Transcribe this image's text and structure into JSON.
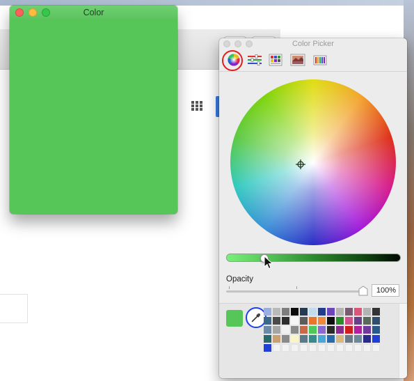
{
  "color_window": {
    "title": "Color",
    "fill_color": "#55c657"
  },
  "color_picker": {
    "title": "Color Picker",
    "mode_tabs": [
      {
        "name": "color-wheel",
        "icon": "color-wheel-icon",
        "selected": true
      },
      {
        "name": "color-sliders",
        "icon": "sliders-icon",
        "selected": false
      },
      {
        "name": "color-palettes",
        "icon": "palette-icon",
        "selected": false
      },
      {
        "name": "image-palettes",
        "icon": "image-palette-icon",
        "selected": false
      },
      {
        "name": "pencils",
        "icon": "pencils-icon",
        "selected": false
      }
    ],
    "brightness_level": 0.22,
    "opacity_label": "Opacity",
    "opacity_value": "100%",
    "current_color": "#55c657",
    "palette_rows": [
      [
        "#9aaee0",
        "#b9b9b9",
        "#7d7d7d",
        "#0a0a0a",
        "#253a53",
        "#c2dcef",
        "#1f3d8a",
        "#6a46ba",
        "#b3b3b3",
        "#7a5a6e",
        "#d9557a",
        "#b3b3b3",
        "#343434"
      ],
      [
        "#3a6a8a",
        "#4a4a4a",
        "#2c2c2c",
        "#f5f5f5",
        "#5c5c5c",
        "#e7762a",
        "#f08a3a",
        "#0f0f0f",
        "#2a8f2a",
        "#d44f8a",
        "#6a3f8a",
        "#5a6a5a",
        "#2f4f6f"
      ],
      [
        "#6a8aaa",
        "#a5a5a5",
        "#f0f0f0",
        "#8a8a8a",
        "#c86a4a",
        "#4ec85a",
        "#8a6ad0",
        "#2a2a2a",
        "#8a2a8a",
        "#cc2020",
        "#b41fa0",
        "#703a9a",
        "#2a5a8a"
      ],
      [
        "#2a6a6a",
        "#c9a070",
        "#8a8a8a",
        "#faf5c8",
        "#5a7a8a",
        "#3a8a8a",
        "#4aa8d8",
        "#2a6aa8",
        "#d8b880",
        "#6a7a8a",
        "#6a8a9a",
        "#2a2a8a",
        "#1f3fd8"
      ],
      [
        "#1f3fd8",
        "empty",
        "empty",
        "empty",
        "empty",
        "empty",
        "empty",
        "empty",
        "empty",
        "empty",
        "empty",
        "empty",
        "empty"
      ]
    ]
  }
}
